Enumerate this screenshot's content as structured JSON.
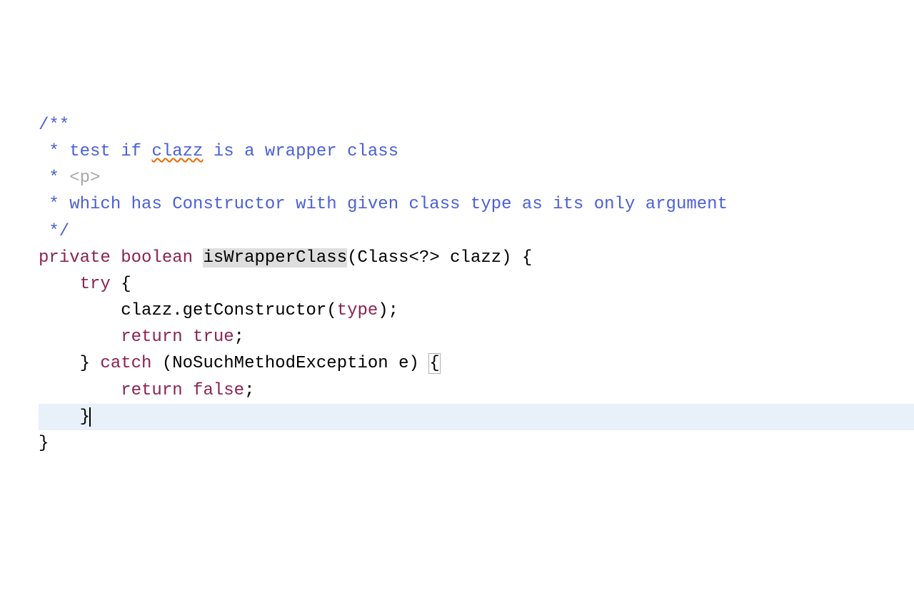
{
  "code": {
    "comment_open": "/**",
    "comment_l1_prefix": " * ",
    "comment_l1_a": "test if ",
    "comment_l1_spell": "clazz",
    "comment_l1_b": " is a wrapper class",
    "comment_l2_prefix": " * ",
    "comment_l2_tag": "<p>",
    "comment_l3_prefix": " * ",
    "comment_l3_text": "which has Constructor with given class type as its only argument",
    "comment_close": " */",
    "decl_kw_private": "private",
    "decl_kw_boolean": "boolean",
    "decl_method": "isWrapperClass",
    "decl_class_type": "Class",
    "decl_generic": "<?>",
    "decl_param": "clazz",
    "decl_open": " {",
    "try_kw": "try",
    "try_open": " {",
    "stmt1_a": "clazz.getConstructor(",
    "stmt1_type": "type",
    "stmt1_b": ");",
    "stmt2_return": "return",
    "stmt2_true": "true",
    "stmt2_semi": ";",
    "catch_close": "}",
    "catch_kw": "catch",
    "catch_open_paren": " (",
    "catch_exc": "NoSuchMethodException e",
    "catch_close_paren": ") ",
    "catch_brace_open": "{",
    "stmt3_return": "return",
    "stmt3_false": "false",
    "stmt3_semi": ";",
    "inner_close": "}",
    "method_close": "}"
  },
  "colors": {
    "comment": "#4a5fd9",
    "keyword": "#8b2252",
    "highlight_bg": "#e8f0f9",
    "method_hl": "#dedede"
  }
}
